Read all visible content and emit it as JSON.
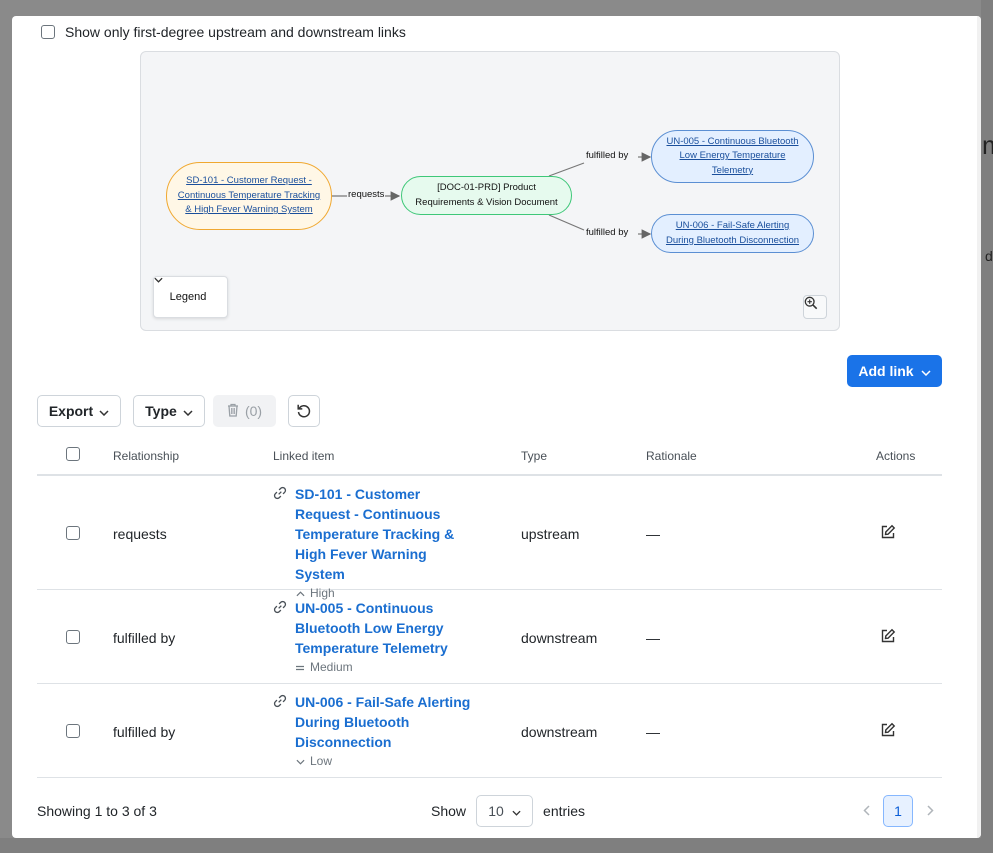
{
  "filter": {
    "first_degree_label": "Show only first-degree upstream and downstream links",
    "checked": false
  },
  "graph": {
    "nodes": {
      "sd101": "SD-101 - Customer Request - Continuous Temperature Tracking & High Fever Warning System",
      "doc": "[DOC-01-PRD] Product Requirements & Vision Document",
      "un005": "UN-005 - Continuous Bluetooth Low Energy Temperature Telemetry",
      "un006": "UN-006 - Fail-Safe Alerting During Bluetooth Disconnection"
    },
    "edges": {
      "requests": "requests",
      "fulfilled_by_1": "fulfilled by",
      "fulfilled_by_2": "fulfilled by"
    },
    "legend_label": "Legend"
  },
  "toolbar": {
    "add_link_label": "Add link",
    "export_label": "Export",
    "type_label": "Type",
    "delete_count": "(0)"
  },
  "table": {
    "headers": {
      "relationship": "Relationship",
      "linked_item": "Linked item",
      "type": "Type",
      "rationale": "Rationale",
      "actions": "Actions"
    },
    "rows": [
      {
        "relationship": "requests",
        "linked_item": "SD-101 - Customer Request - Continuous Temperature Tracking & High Fever Warning System",
        "priority": "High",
        "type": "upstream",
        "rationale": "—"
      },
      {
        "relationship": "fulfilled by",
        "linked_item": "UN-005 - Continuous Bluetooth Low Energy Temperature Telemetry",
        "priority": "Medium",
        "type": "downstream",
        "rationale": "—"
      },
      {
        "relationship": "fulfilled by",
        "linked_item": "UN-006 - Fail-Safe Alerting During Bluetooth Disconnection",
        "priority": "Low",
        "type": "downstream",
        "rationale": "—"
      }
    ]
  },
  "footer": {
    "showing": "Showing 1 to 3 of 3",
    "show_label": "Show",
    "per_page": "10",
    "entries_label": "entries",
    "current_page": "1"
  },
  "edge_peek": {
    "m": "m",
    "d": "d"
  },
  "colors": {
    "primary": "#1a73e8",
    "link": "#1a6ed0",
    "node_sd_border": "#f0a830",
    "node_doc_border": "#3ec778",
    "node_un_border": "#5b8fd3"
  }
}
